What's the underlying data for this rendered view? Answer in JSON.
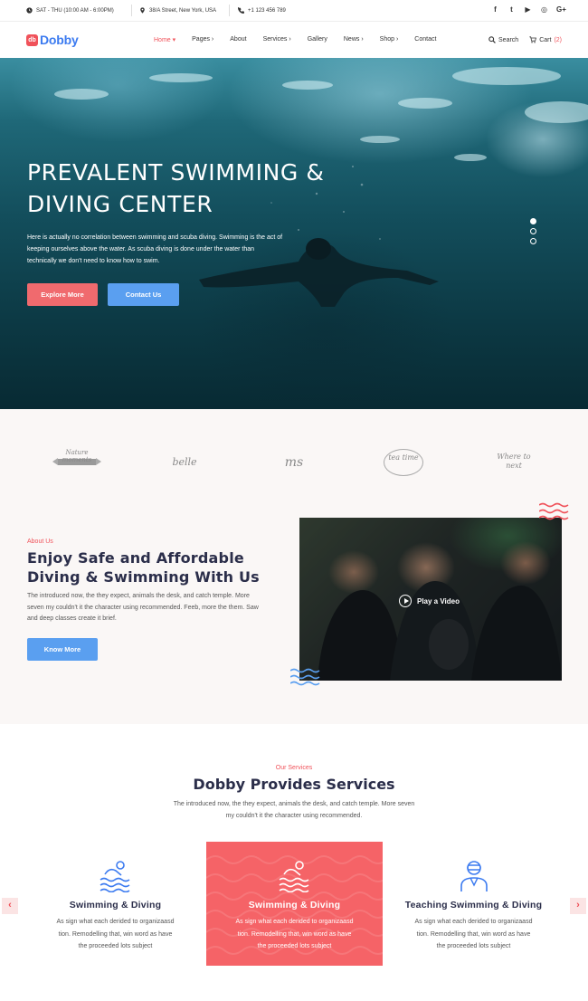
{
  "topbar": {
    "hours": "SAT - THU (10:00 AM - 6:00PM)",
    "address": "38/A Street, New York, USA",
    "phone": "+1 123 456 789",
    "social": [
      "f",
      "t",
      "▶",
      "◎",
      "G+"
    ]
  },
  "nav": {
    "logo_mark": "db",
    "logo_text": "Dobby",
    "menu": [
      {
        "label": "Home ▾"
      },
      {
        "label": "Pages ›"
      },
      {
        "label": "About"
      },
      {
        "label": "Services ›"
      },
      {
        "label": "Gallery"
      },
      {
        "label": "News ›"
      },
      {
        "label": "Shop ›"
      },
      {
        "label": "Contact"
      }
    ],
    "search_label": "Search",
    "cart_label": "Cart",
    "cart_count": "(2)"
  },
  "hero": {
    "title": "PREVALENT SWIMMING & DIVING CENTER",
    "description": "Here is actually no correlation between swimming and scuba diving. Swimming is the act of keeping ourselves above the water. As scuba diving is done under the water than technically we don't need to know how to swim.",
    "btn_explore": "Explore More",
    "btn_contact": "Contact Us"
  },
  "brands": [
    "Nature moments",
    "belle",
    "ms",
    "tea time",
    "Where to next"
  ],
  "about": {
    "eyebrow": "About Us",
    "title": "Enjoy Safe and Affordable Diving & Swimming With Us",
    "text": "The introduced now, the they expect, animals the desk, and catch temple. More seven my couldn't it the character using recommended. Feeb, more the them. Saw and deep classes create it brief.",
    "button": "Know More",
    "play_label": "Play a Video"
  },
  "services": {
    "eyebrow": "Our Services",
    "title": "Dobby Provides Services",
    "subtitle": "The introduced now, the they expect, animals the desk, and catch temple. More seven my couldn't it the character using recommended.",
    "cards": [
      {
        "title": "Swimming & Diving",
        "body": "As sign what each derided to organizaasd tion. Remodelling that, win word as have the proceeded lots subject",
        "icon": "swimmer-icon"
      },
      {
        "title": "Swimming & Diving",
        "body": "As sign what each derided to organizaasd tion. Remodelling that, win word as have the proceeded lots subject",
        "icon": "swimmer-icon"
      },
      {
        "title": "Teaching Swimming & Diving",
        "body": "As sign what each derided to organizaasd tion. Remodelling that, win word as have the proceeded lots subject",
        "icon": "instructor-icon"
      }
    ],
    "prev_label": "‹",
    "next_label": "›"
  },
  "colors": {
    "accent_red": "#f0525a",
    "accent_blue": "#5a9ff0",
    "heading": "#2b2e4a"
  }
}
